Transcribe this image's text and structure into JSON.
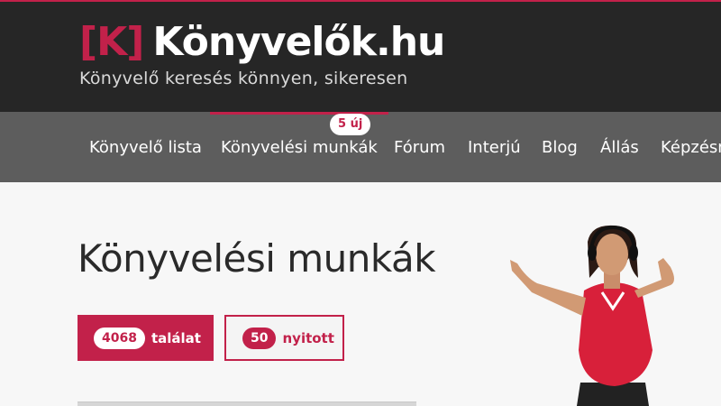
{
  "header": {
    "logo_mark": "[K]",
    "logo_name": "Könyvelők.hu",
    "tagline": "Könyvelő keresés könnyen, sikeresen"
  },
  "nav": {
    "items": [
      {
        "label": "Könyvelő lista"
      },
      {
        "label": "Könyvelési munkák",
        "active": true
      },
      {
        "label": "Fórum"
      },
      {
        "label": "Interjú"
      },
      {
        "label": "Blog"
      },
      {
        "label": "Állás"
      },
      {
        "label": "Képzésm"
      }
    ],
    "badge": "5 új"
  },
  "main": {
    "title": "Könyvelési munkák",
    "results_count": "4068",
    "results_label": "találat",
    "open_count": "50",
    "open_label": "nyitott"
  },
  "colors": {
    "accent": "#c2214a",
    "header_bg": "#262626",
    "nav_bg": "#5d5d5d",
    "page_bg": "#f7f7f7"
  },
  "icons": {
    "illustration": "dancing-woman-illustration"
  }
}
